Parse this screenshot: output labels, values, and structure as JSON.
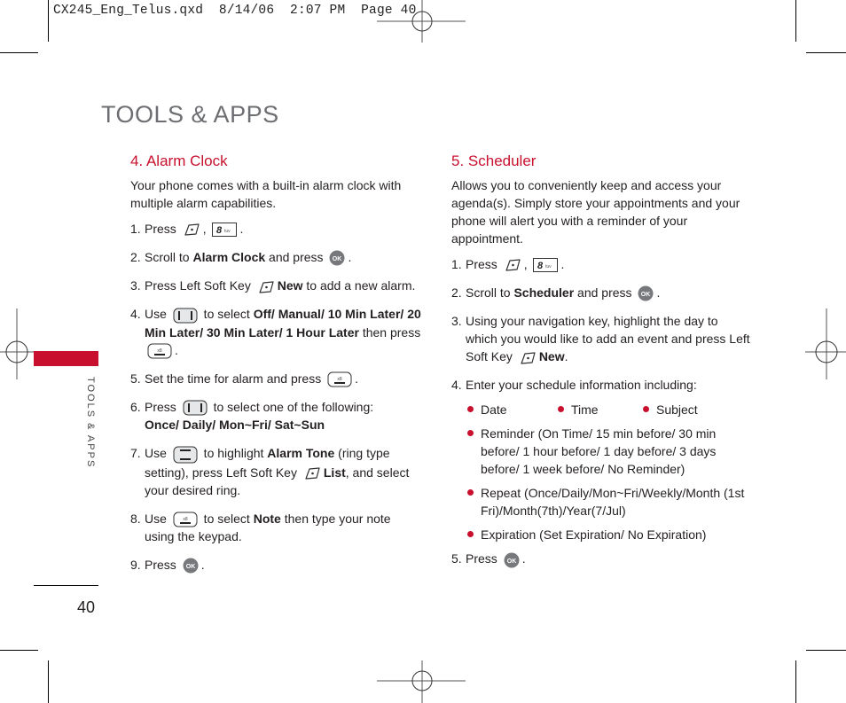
{
  "slug": "CX245_Eng_Telus.qxd  8/14/06  2:07 PM  Page 40",
  "page_title": "TOOLS & APPS",
  "side_tab": {
    "label": "TOOLS & APPS",
    "color": "#c8102e"
  },
  "page_number": "40",
  "accent_color": "#c8102e",
  "left": {
    "heading": "4. Alarm Clock",
    "intro": "Your phone comes with a built-in alarm clock with multiple alarm capabilities.",
    "steps": [
      {
        "num": "1.",
        "a": "Press",
        "b": ",",
        "c": "."
      },
      {
        "num": "2.",
        "a": "Scroll to ",
        "bold": "Alarm Clock",
        "c": " and press",
        "d": "."
      },
      {
        "num": "3.",
        "a": "Press Left Soft Key",
        "bold": "New",
        "c": " to add a new alarm."
      },
      {
        "num": "4.",
        "a": "Use",
        "b": " to select ",
        "bold": "Off/ Manual/ 10 Min Later/ 20 Min Later/ 30 Min Later/ 1 Hour Later",
        "c": " then press",
        "d": "."
      },
      {
        "num": "5.",
        "a": "Set the time for alarm and press",
        "d": "."
      },
      {
        "num": "6.",
        "a": "Press",
        "b": " to select one of the following:",
        "bold": "Once/ Daily/ Mon~Fri/ Sat~Sun"
      },
      {
        "num": "7.",
        "a": "Use",
        "b": " to highlight ",
        "bold": "Alarm Tone",
        "c": " (ring type setting), press Left Soft Key",
        "bold2": "List",
        "d": ", and select your desired ring."
      },
      {
        "num": "8.",
        "a": "Use",
        "b": " to select ",
        "bold": "Note",
        "c": " then type your note using the keypad."
      },
      {
        "num": "9.",
        "a": "Press",
        "d": "."
      }
    ]
  },
  "right": {
    "heading": "5. Scheduler",
    "intro": "Allows you to conveniently keep and access your agenda(s). Simply store your appointments and your phone will alert you with a reminder of your appointment.",
    "steps": [
      {
        "num": "1.",
        "a": "Press",
        "b": ",",
        "c": "."
      },
      {
        "num": "2.",
        "a": "Scroll to ",
        "bold": "Scheduler",
        "c": " and press",
        "d": "."
      },
      {
        "num": "3.",
        "a": "Using your navigation key, highlight the day to which you would like to add an event and press Left Soft Key",
        "bold": "New",
        "c": "."
      },
      {
        "num": "4.",
        "a": "Enter your schedule information including:"
      },
      {
        "num": "5.",
        "a": "Press",
        "d": "."
      }
    ],
    "inline_bullets": [
      "Date",
      "Time",
      "Subject"
    ],
    "bullets": [
      "Reminder (On Time/ 15 min before/ 30 min before/ 1 hour before/ 1 day before/ 3 days before/ 1 week before/ No Reminder)",
      "Repeat (Once/Daily/Mon~Fri/Weekly/Month (1st Fri)/Month(7th)/Year(7/Jul)",
      "Expiration (Set Expiration/ No Expiration)"
    ]
  },
  "icons": {
    "left_soft_key": "left-soft-key-icon",
    "key_8": "8 tuv",
    "ok_key": "OK",
    "nav_left_right": "nav-left-right-key-icon",
    "nav_up_down": "nav-up-down-key-icon",
    "nav_down": "nav-down-key-icon"
  }
}
